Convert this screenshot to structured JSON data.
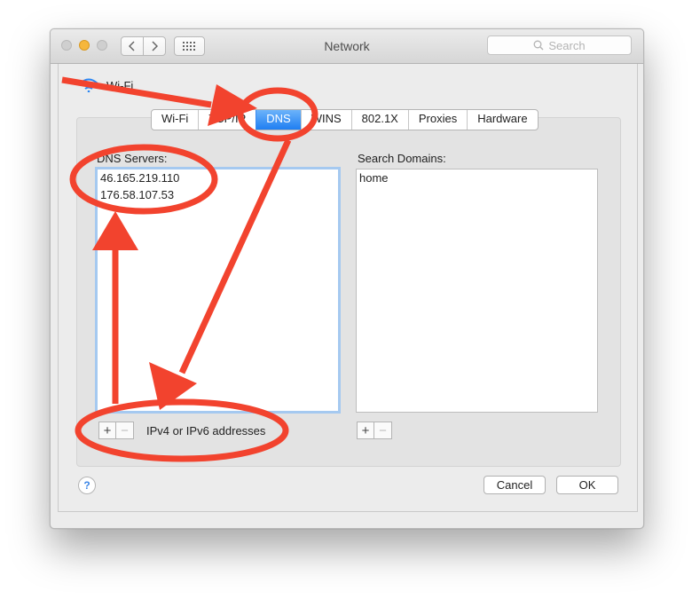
{
  "window": {
    "title": "Network"
  },
  "toolbar": {
    "search_placeholder": "Search"
  },
  "connection": {
    "name": "Wi-Fi"
  },
  "tabs": [
    {
      "label": "Wi-Fi"
    },
    {
      "label": "TCP/IP"
    },
    {
      "label": "DNS",
      "active": true
    },
    {
      "label": "WINS"
    },
    {
      "label": "802.1X"
    },
    {
      "label": "Proxies"
    },
    {
      "label": "Hardware"
    }
  ],
  "dns": {
    "label": "DNS Servers:",
    "servers": [
      "46.165.219.110",
      "176.58.107.53"
    ],
    "hint": "IPv4 or IPv6 addresses"
  },
  "search_domains": {
    "label": "Search Domains:",
    "domains": [
      "home"
    ]
  },
  "buttons": {
    "cancel": "Cancel",
    "ok": "OK",
    "help": "?",
    "add": "+",
    "remove": "−"
  },
  "colors": {
    "annotation": "#f2432e",
    "accent": "#2a86f3"
  }
}
